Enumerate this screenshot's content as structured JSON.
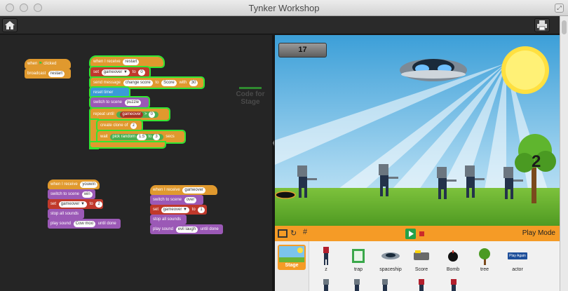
{
  "window": {
    "title": "Tynker Workshop"
  },
  "code": {
    "stage_label_line1": "Code for",
    "stage_label_line2": "Stage",
    "script1": {
      "hat": "when",
      "hat_tail": "clicked",
      "broadcast": "broadcast",
      "broadcast_arg": "restart"
    },
    "script2": {
      "hat": "when I receive",
      "hat_arg": "restart",
      "set": "set",
      "set_var": "gameover ▼",
      "set_to": "to",
      "set_val": "0",
      "send": "send message",
      "send_arg": "change score",
      "send_to": "to",
      "send_target": "Score",
      "send_with": "with",
      "send_val": "30",
      "reset_timer": "reset timer",
      "switch": "switch to scene",
      "switch_arg": "puzzle",
      "repeat": "repeat until",
      "cond_var": "gameover",
      "cond_op": ">",
      "cond_val": "0",
      "clone": "create clone of",
      "clone_arg": "z",
      "wait": "wait",
      "random": "pick random",
      "rand_a": "1.5",
      "rand_to": "to",
      "rand_b": "3",
      "secs": "secs"
    },
    "script3": {
      "hat": "when I receive",
      "hat_arg": "youwin",
      "switch": "switch to scene",
      "switch_arg": "win",
      "set": "set",
      "set_var": "gameover ▼",
      "set_to": "to",
      "set_val": "2",
      "stop": "stop all sounds",
      "play": "play sound",
      "play_arg": "Cow moo",
      "until": "until done"
    },
    "script4": {
      "hat": "when I receive",
      "hat_arg": "gameover",
      "switch": "switch to scene",
      "switch_arg": "over",
      "set": "set",
      "set_var": "gameover ▼",
      "set_to": "to",
      "set_val": "1",
      "stop": "stop all sounds",
      "play": "play sound",
      "play_arg": "evil laugh",
      "until": "until done"
    }
  },
  "stage": {
    "score": "17",
    "level_digit": "2"
  },
  "controls": {
    "play_mode": "Play Mode"
  },
  "actors": {
    "stage_label": "Stage",
    "items": [
      {
        "label": "z",
        "icon": "zombie-icon"
      },
      {
        "label": "trap",
        "icon": "trap-icon"
      },
      {
        "label": "spaceship",
        "icon": "spaceship-icon"
      },
      {
        "label": "Score",
        "icon": "score-icon"
      },
      {
        "label": "Bomb",
        "icon": "bomb-icon"
      },
      {
        "label": "tree",
        "icon": "tree-icon"
      },
      {
        "label": "actor",
        "icon": "play-again-icon"
      }
    ],
    "play_again": "Play Again"
  },
  "colors": {
    "accent": "#f59b26",
    "highlight": "#32e632",
    "event_block": "#e0992e",
    "data_block": "#c0392b",
    "looks_block": "#9b59b6",
    "sensing_block": "#3a9bd8",
    "play_green": "#24a148"
  }
}
